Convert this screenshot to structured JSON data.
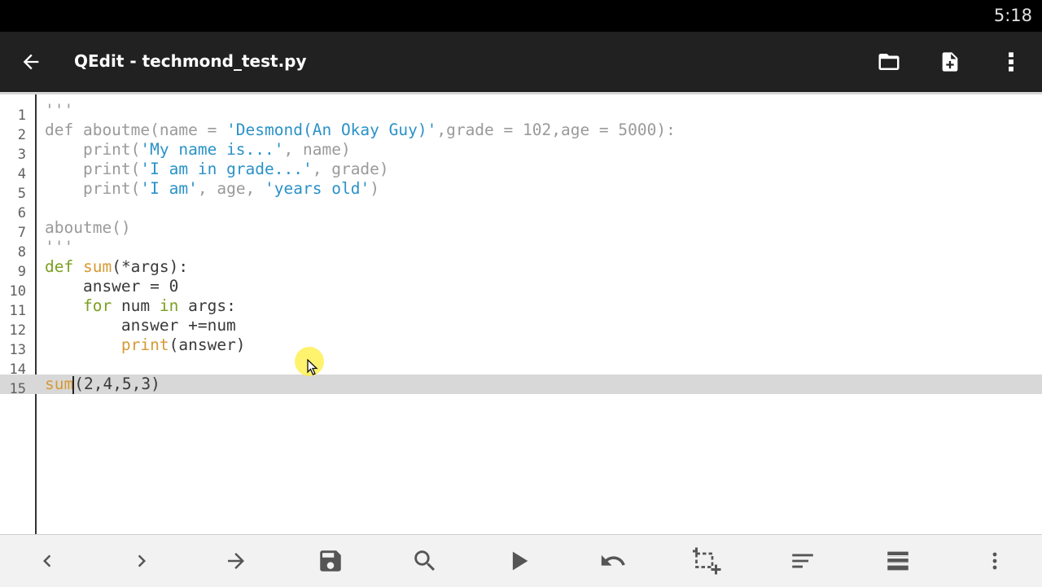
{
  "status_bar": {
    "time": "5:18"
  },
  "app_bar": {
    "title": "QEdit - techmond_test.py",
    "icons": [
      "arrow-back-icon",
      "folder-icon",
      "new-file-icon",
      "more-vert-icon"
    ]
  },
  "editor": {
    "lines": [
      {
        "n": "1",
        "tokens": [
          [
            "cm",
            "'''"
          ]
        ]
      },
      {
        "n": "2",
        "tokens": [
          [
            "cm",
            "def aboutme(name = "
          ],
          [
            "str",
            "'Desmond(An Okay Guy)'"
          ],
          [
            "cm",
            ",grade = 102,age = 5000):"
          ]
        ]
      },
      {
        "n": "3",
        "tokens": [
          [
            "cm",
            "    print("
          ],
          [
            "str",
            "'My name is...'"
          ],
          [
            "cm",
            ", name)"
          ]
        ]
      },
      {
        "n": "4",
        "tokens": [
          [
            "cm",
            "    print("
          ],
          [
            "str",
            "'I am in grade...'"
          ],
          [
            "cm",
            ", grade)"
          ]
        ]
      },
      {
        "n": "5",
        "tokens": [
          [
            "cm",
            "    print("
          ],
          [
            "str",
            "'I am'"
          ],
          [
            "cm",
            ", age, "
          ],
          [
            "str",
            "'years old'"
          ],
          [
            "cm",
            ")"
          ]
        ]
      },
      {
        "n": "6",
        "tokens": []
      },
      {
        "n": "7",
        "tokens": [
          [
            "cm",
            "aboutme()"
          ]
        ]
      },
      {
        "n": "8",
        "tokens": [
          [
            "cm",
            "'''"
          ]
        ]
      },
      {
        "n": "9",
        "tokens": [
          [
            "kw",
            "def "
          ],
          [
            "fn",
            "sum"
          ],
          [
            "txt",
            "(*args):"
          ]
        ]
      },
      {
        "n": "10",
        "tokens": [
          [
            "txt",
            "    answer = 0"
          ]
        ]
      },
      {
        "n": "11",
        "tokens": [
          [
            "txt",
            "    "
          ],
          [
            "kw",
            "for"
          ],
          [
            "txt",
            " num "
          ],
          [
            "kw",
            "in"
          ],
          [
            "txt",
            " args:"
          ]
        ]
      },
      {
        "n": "12",
        "tokens": [
          [
            "txt",
            "        answer +=num"
          ]
        ]
      },
      {
        "n": "13",
        "tokens": [
          [
            "txt",
            "        "
          ],
          [
            "fn",
            "print"
          ],
          [
            "txt",
            "(answer)"
          ]
        ]
      },
      {
        "n": "14",
        "tokens": []
      },
      {
        "n": "15",
        "tokens": [
          [
            "fn",
            "sum"
          ],
          [
            "caret",
            ""
          ],
          [
            "txt",
            "(2,4,5,3)"
          ]
        ],
        "current": true
      }
    ]
  },
  "bottom_toolbar": {
    "icons": [
      "chevron-left-icon",
      "chevron-right-icon",
      "arrow-right-icon",
      "save-icon",
      "search-icon",
      "play-icon",
      "undo-icon",
      "select-add-icon",
      "sort-lines-icon",
      "list-icon",
      "more-vert-icon"
    ]
  },
  "colors": {
    "status_bar": "#000000",
    "app_bar": "#212121",
    "keyword": "#7aa020",
    "function": "#d69a34",
    "string": "#2a92c8",
    "comment": "#9a9a9a",
    "current_line": "#d8d8d8",
    "bottom_bar": "#f2f2f2"
  }
}
